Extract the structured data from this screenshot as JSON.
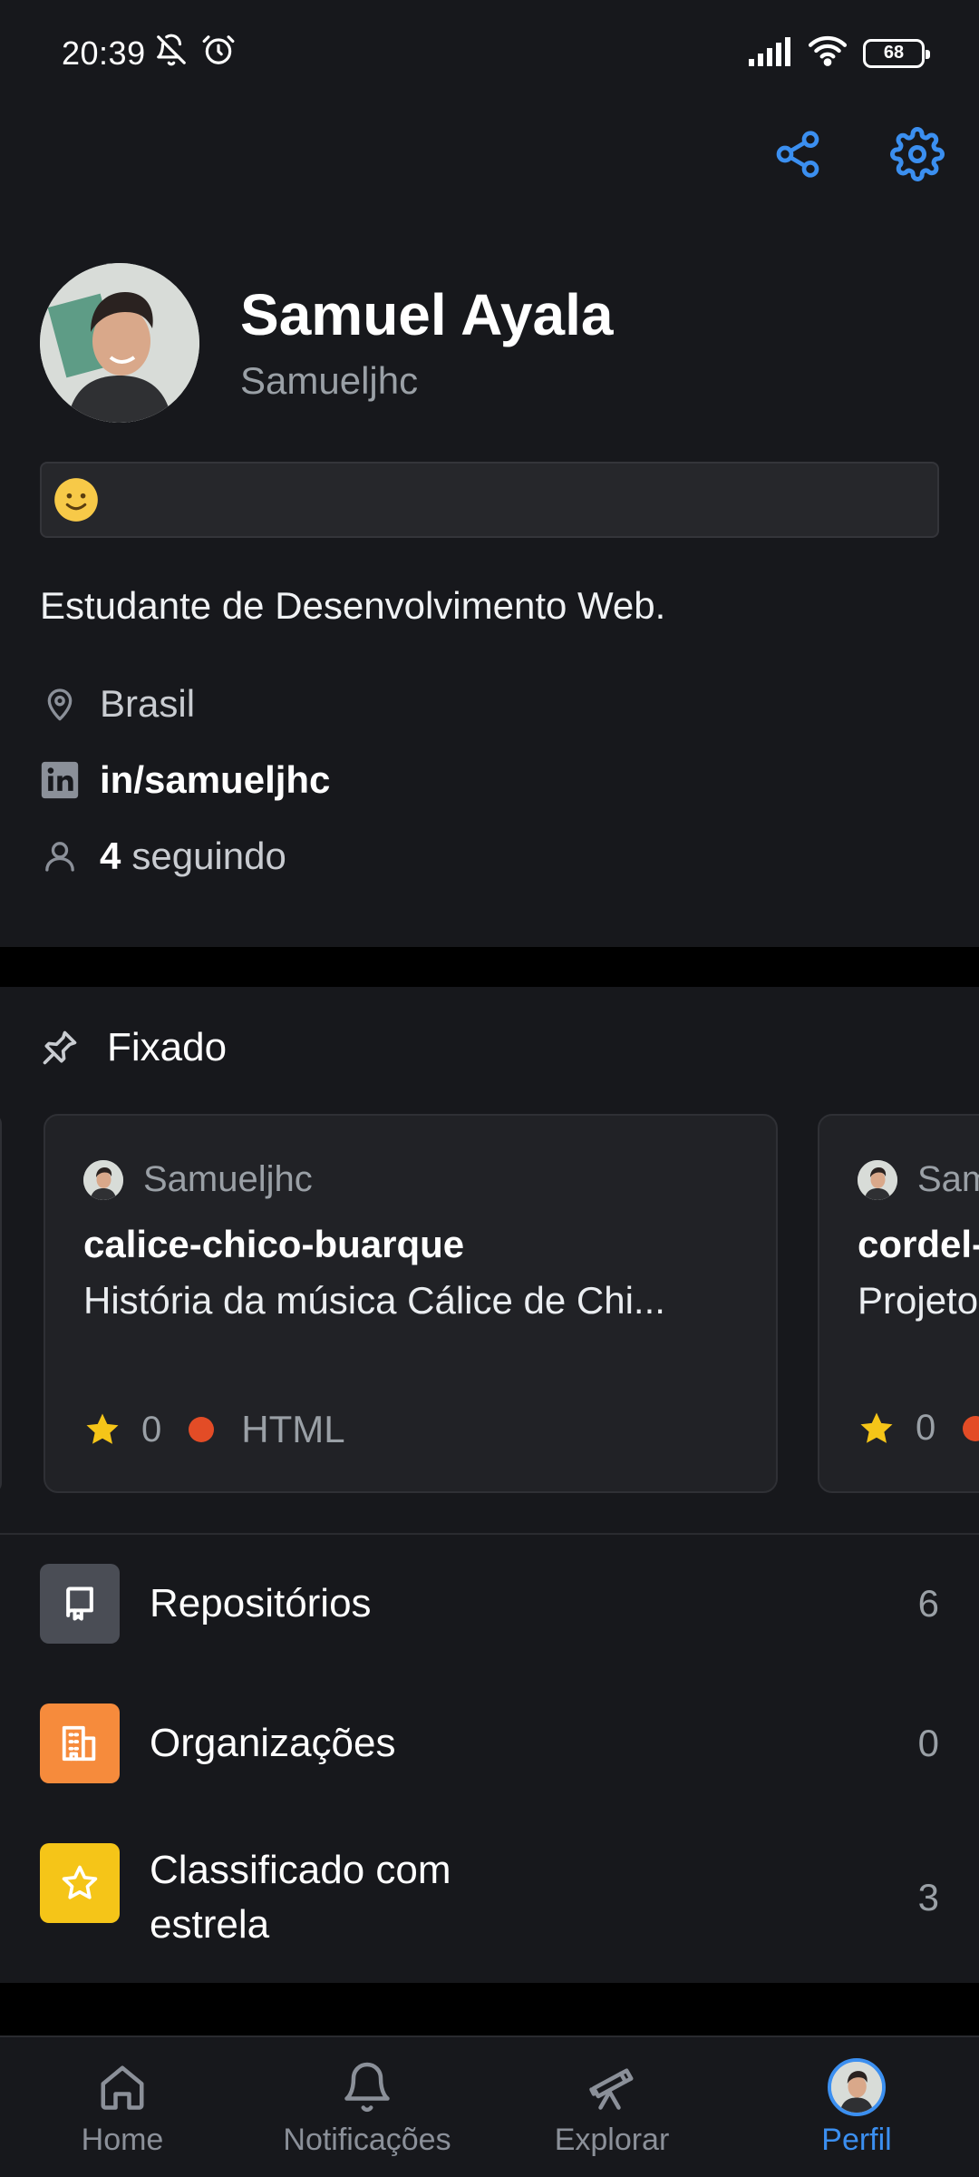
{
  "status_bar": {
    "time": "20:39",
    "battery": "68"
  },
  "profile": {
    "name": "Samuel Ayala",
    "login": "Samueljhc",
    "status_emoji": "slightly-smiling-face",
    "bio": "Estudante de Desenvolvimento Web.",
    "location": "Brasil",
    "linkedin": "in/samueljhc",
    "following_count": "4",
    "following_label": "seguindo"
  },
  "pinned": {
    "title": "Fixado",
    "cards": [
      {
        "owner": "Samueljhc",
        "repo": "calice-chico-buarque",
        "description": "História da música Cálice de Chi...",
        "stars": "0",
        "language": "HTML",
        "language_color": "#e34c26"
      },
      {
        "owner": "Sam",
        "repo": "cordel-",
        "description": "Projeto",
        "stars": "0",
        "language": "",
        "language_color": "#e34c26"
      }
    ]
  },
  "menu": [
    {
      "label": "Repositórios",
      "count": "6",
      "icon": "repo-icon",
      "color": "#4a4d55"
    },
    {
      "label": "Organizações",
      "count": "0",
      "icon": "organization-icon",
      "color": "#f68b3c"
    },
    {
      "label_line1": "Classificado com",
      "label_line2": "estrela",
      "count": "3",
      "icon": "star-icon",
      "color": "#f5c518"
    }
  ],
  "bottom_nav": [
    {
      "label": "Home",
      "icon": "home-icon"
    },
    {
      "label": "Notificações",
      "icon": "bell-icon"
    },
    {
      "label": "Explorar",
      "icon": "telescope-icon"
    },
    {
      "label": "Perfil",
      "icon": "avatar",
      "active": true
    }
  ]
}
